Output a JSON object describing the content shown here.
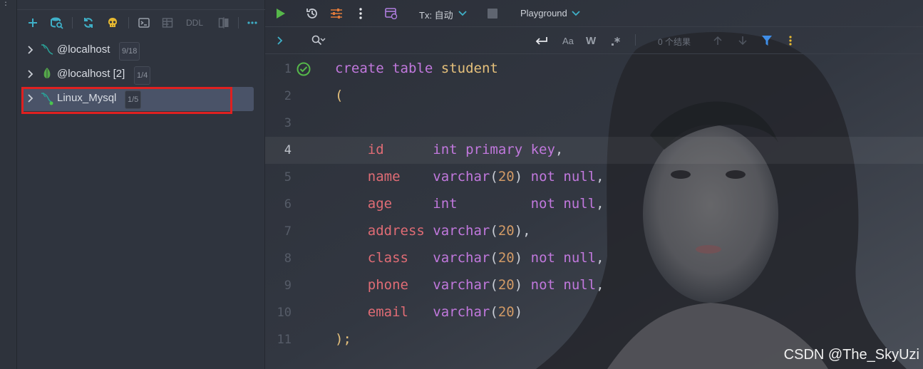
{
  "left_strip": {
    "dots": "⋮"
  },
  "explorer": {
    "toolbar": {
      "add_icon": "plus-icon",
      "datasource_icon": "database-search-icon",
      "refresh_icon": "refresh-icon",
      "skull_icon": "skull-icon",
      "console_icon": "console-icon",
      "table_icon": "table-icon",
      "ddl_label": "DDL",
      "compare_icon": "compare-icon",
      "more_icon": "more-icon"
    },
    "items": [
      {
        "label": "@localhost",
        "badge": "9/18",
        "icon": "mysql-icon"
      },
      {
        "label": "@localhost [2]",
        "badge": "1/4",
        "icon": "mongodb-leaf-icon"
      },
      {
        "label": "Linux_Mysql",
        "badge": "1/5",
        "icon": "mysql-connected-icon"
      }
    ]
  },
  "editor": {
    "toolbar": {
      "run_icon": "play-icon",
      "history_icon": "history-icon",
      "settings_icon": "sliders-icon",
      "more_icon": "vertical-dots-icon",
      "session_icon": "session-icon",
      "tx_label": "Tx: 自动",
      "stop_icon": "stop-icon",
      "playground_label": "Playground"
    },
    "find_bar": {
      "expand_icon": "chevron-right-icon",
      "search_icon": "search-icon",
      "newline_icon": "newline-icon",
      "match_case_label": "Aa",
      "words_label": "W",
      "regex_icon": "regex-icon",
      "result_count": "0 个结果",
      "prev_icon": "arrow-up-icon",
      "next_icon": "arrow-down-icon",
      "filter_icon": "filter-icon",
      "options_icon": "vertical-dots-icon"
    },
    "current_line": 4,
    "lines": [
      {
        "n": "1"
      },
      {
        "n": "2"
      },
      {
        "n": "3"
      },
      {
        "n": "4"
      },
      {
        "n": "5"
      },
      {
        "n": "6"
      },
      {
        "n": "7"
      },
      {
        "n": "8"
      },
      {
        "n": "9"
      },
      {
        "n": "10"
      },
      {
        "n": "11"
      }
    ],
    "code": {
      "l1_kw1": "create",
      "l1_kw2": "table",
      "l1_name": "student",
      "l2": "(",
      "l4_col": "id",
      "l4_type": "int",
      "l4_mod": "primary key",
      "l4_end": ",",
      "l5_col": "name",
      "l5_type": "varchar",
      "l5_num": "20",
      "l5_mod": "not null",
      "l5_end": ",",
      "l6_col": "age",
      "l6_type": "int",
      "l6_mod": "not null",
      "l6_end": ",",
      "l7_col": "address",
      "l7_type": "varchar",
      "l7_num": "20",
      "l7_end": ",",
      "l8_col": "class",
      "l8_type": "varchar",
      "l8_num": "20",
      "l8_mod": "not null",
      "l8_end": ",",
      "l9_col": "phone",
      "l9_type": "varchar",
      "l9_num": "20",
      "l9_mod": "not null",
      "l9_end": ",",
      "l10_col": "email",
      "l10_type": "varchar",
      "l10_num": "20",
      "l11": ");"
    },
    "watermark": "CSDN @The_SkyUzi"
  }
}
